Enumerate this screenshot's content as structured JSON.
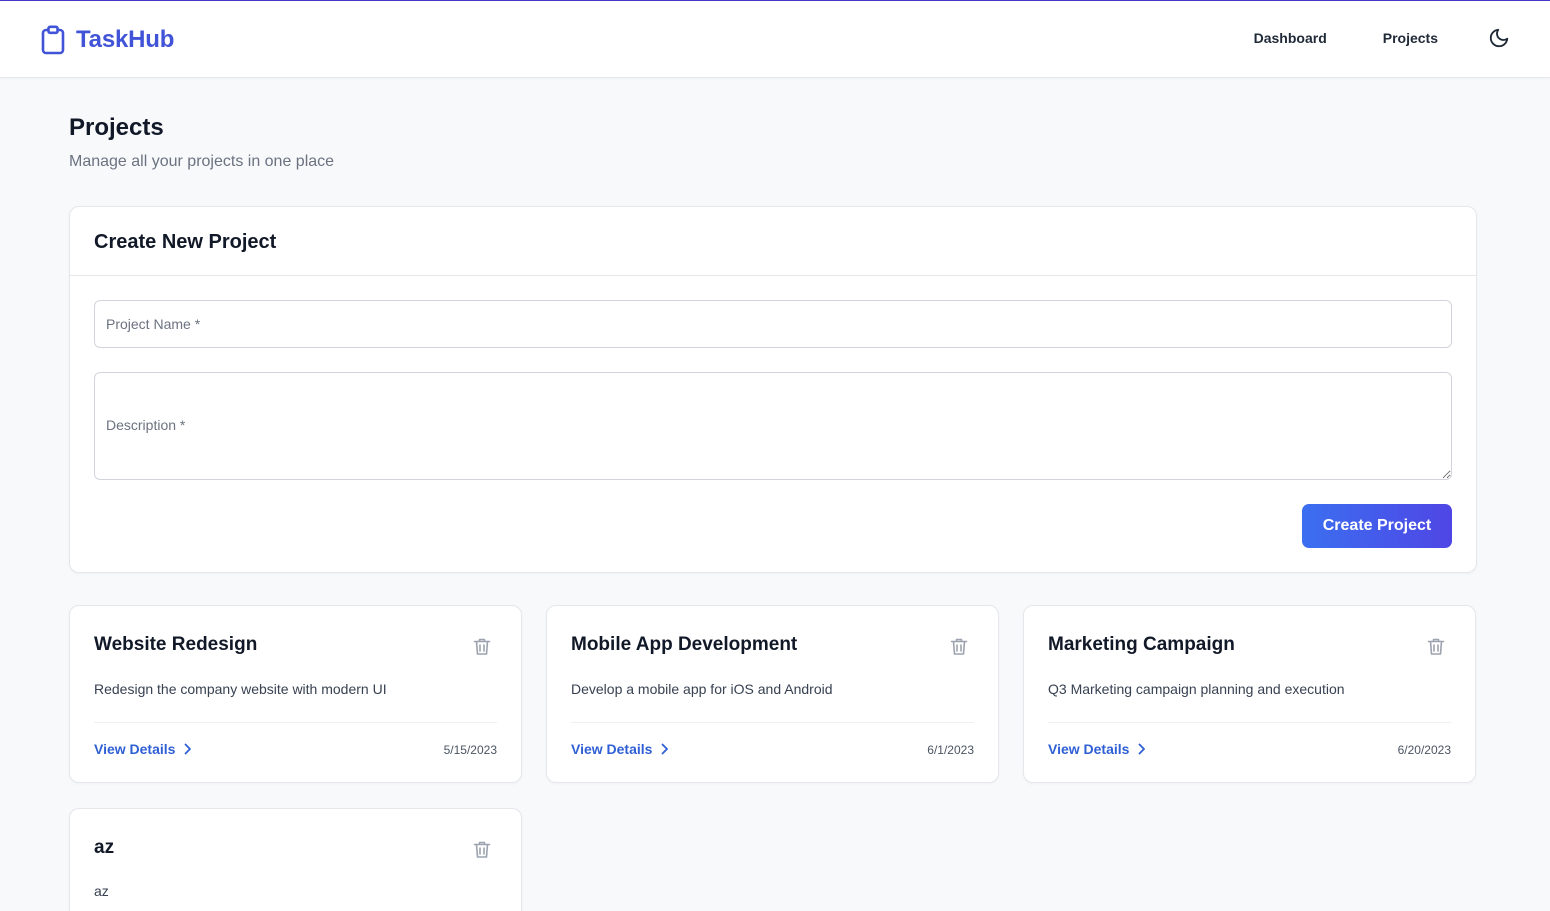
{
  "app": {
    "name": "TaskHub",
    "accent": "#4154d8"
  },
  "nav": {
    "dashboard": "Dashboard",
    "projects": "Projects",
    "theme_icon": "moon-icon"
  },
  "page": {
    "title": "Projects",
    "subtitle": "Manage all your projects in one place"
  },
  "create_form": {
    "title": "Create New Project",
    "name_placeholder": "Project Name *",
    "description_placeholder": "Description *",
    "submit_label": "Create Project"
  },
  "projects": [
    {
      "title": "Website Redesign",
      "description": "Redesign the company website with modern UI",
      "link": "View Details",
      "date": "5/15/2023"
    },
    {
      "title": "Mobile App Development",
      "description": "Develop a mobile app for iOS and Android",
      "link": "View Details",
      "date": "6/1/2023"
    },
    {
      "title": "Marketing Campaign",
      "description": "Q3 Marketing campaign planning and execution",
      "link": "View Details",
      "date": "6/20/2023"
    },
    {
      "title": "az",
      "description": "az"
    }
  ]
}
